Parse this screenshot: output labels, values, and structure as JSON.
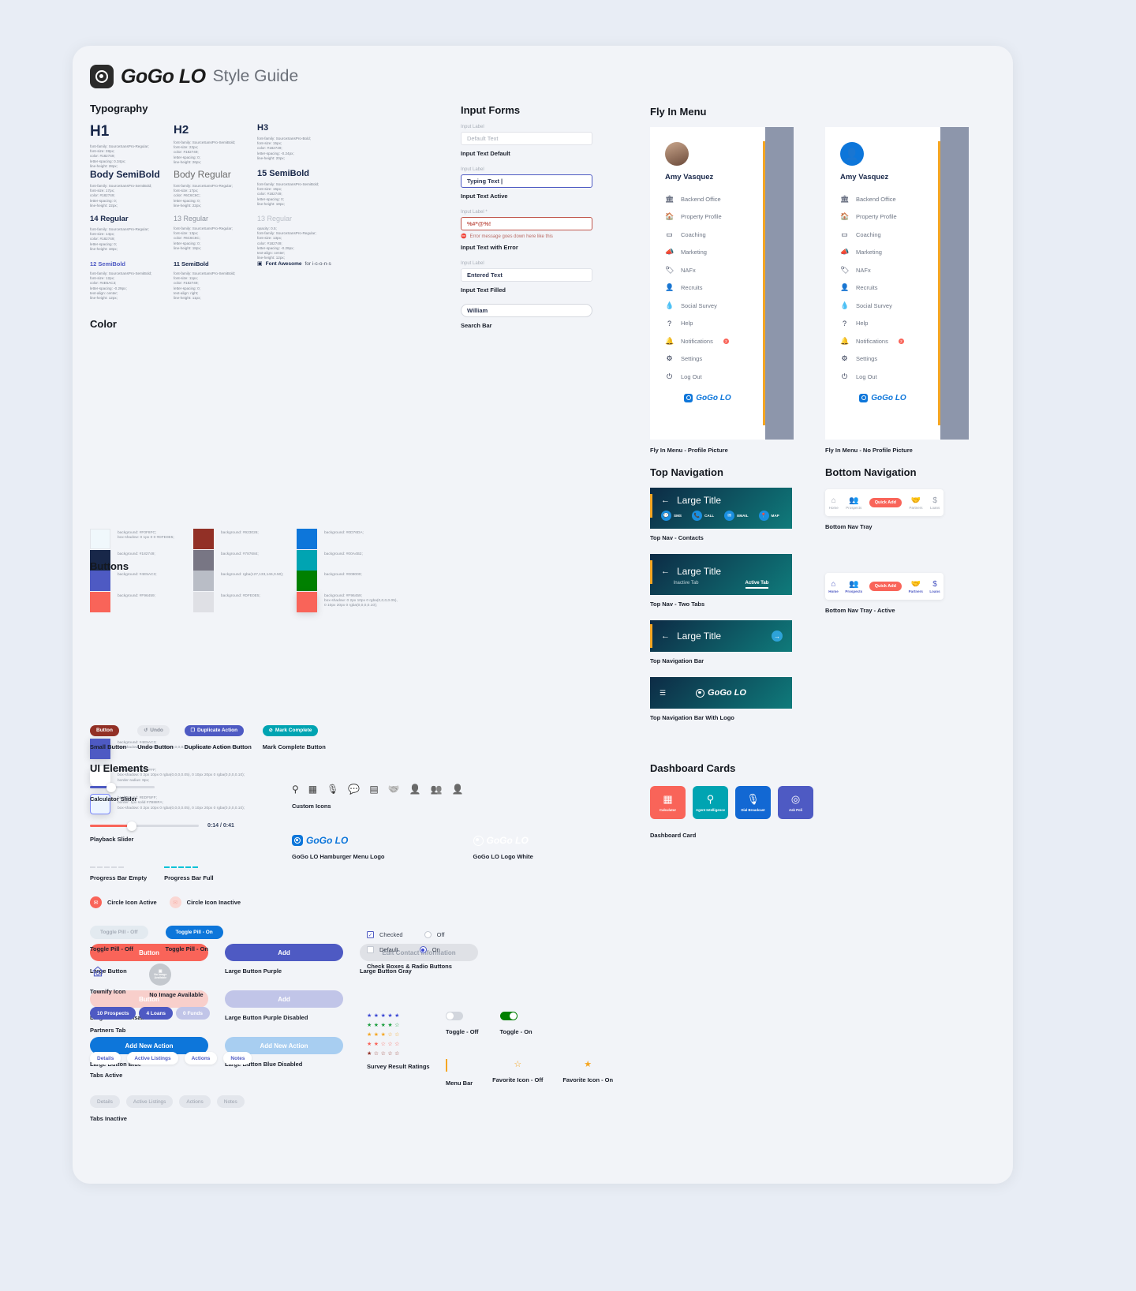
{
  "header": {
    "brand": "GoGo LO",
    "subtitle": "Style Guide"
  },
  "sections": {
    "typography": "Typography",
    "color": "Color",
    "buttons": "Buttons",
    "ui_elements": "UI Elements",
    "input_forms": "Input Forms",
    "fly_in_menu": "Fly In Menu",
    "top_navigation": "Top Navigation",
    "bottom_navigation": "Bottom Navigation",
    "dashboard_cards": "Dashboard Cards"
  },
  "typography": [
    {
      "name": "H1",
      "size": "28px",
      "weight": "bold",
      "color": "#182749",
      "spec": "font-family: SourceSansPro-Regular;\nfont-size: 28px;\ncolor: #182749;\nletter-spacing: 0.34px;\nline-height: 28px;"
    },
    {
      "name": "H2",
      "size": "22px",
      "weight": "bold",
      "color": "#182749",
      "spec": "font-family: SourceSansPro-SemiBold;\nfont-size: 22px;\ncolor: #182749;\nletter-spacing: 0;\nline-height: 26px;"
    },
    {
      "name": "H3",
      "size": "15px",
      "weight": "bold",
      "color": "#182749",
      "spec": "font-family: SourceSansPro-Bold;\nfont-size: 15px;\ncolor: #182749;\nletter-spacing: -0.24px;\nline-height: 20px;"
    },
    {
      "name": "Body SemiBold",
      "size": "17px",
      "weight": "bold",
      "color": "#182749",
      "spec": "font-family: SourceSansPro-SemiBold;\nfont-size: 17px;\ncolor: #182749;\nletter-spacing: 0;\nline-height: 22px;"
    },
    {
      "name": "Body Regular",
      "size": "17px",
      "weight": "normal",
      "color": "#6C6C6C",
      "spec": "font-family: SourceSansPro-Regular;\nfont-size: 17px;\ncolor: #6C6C6C;\nletter-spacing: 0;\nline-height: 22px;"
    },
    {
      "name": "15 SemiBold",
      "size": "15px",
      "weight": "bold",
      "color": "#182749",
      "spec": "font-family: SourceSansPro-SemiBold;\nfont-size: 15px;\ncolor: #182749;\nletter-spacing: 0;\nline-height: 18px;"
    },
    {
      "name": "14 Regular",
      "size": "14px",
      "weight": "bold",
      "color": "#182749",
      "spec": "font-family: SourceSansPro-Regular;\nfont-size: 14px;\ncolor: #182749;\nletter-spacing: 0;\nline-height: 18px;"
    },
    {
      "name": "13 Regular",
      "size": "13px",
      "weight": "normal",
      "color": "#8d939e",
      "spec": "font-family: SourceSansPro-Regular;\nfont-size: 13px;\ncolor: #6C6C6C;\nletter-spacing: 0;\nline-height: 18px;"
    },
    {
      "name": "13 Regular",
      "size": "13px",
      "weight": "normal",
      "color": "#b9bec7",
      "spec": "opacity: 0.5;\nfont-family: SourceSansPro-Regular;\nfont-size: 13px;\ncolor: #182749;\nletter-spacing: -0.29px;\ntext-align: center;\nline-height: 12px;"
    },
    {
      "name": "12 SemiBold",
      "size": "12px",
      "weight": "bold",
      "color": "#4E5AC3",
      "spec": "font-family: SourceSansPro-SemiBold;\nfont-size: 12px;\ncolor: #4E5AC3;\nletter-spacing: -0.29px;\ntext-align: center;\nline-height: 12px;"
    },
    {
      "name": "11 SemiBold",
      "size": "11px",
      "weight": "bold",
      "color": "#182749",
      "spec": "font-family: SourceSansPro-SemiBold;\nfont-size: 11px;\ncolor: #182749;\nletter-spacing: 0;\ntext-align: right;\nline-height: 11px;"
    }
  ],
  "font_awesome_note": {
    "bold": "Font Awesome",
    "rest": "for i-c-o-n-s"
  },
  "colors": [
    {
      "hex": "#F0F8FC",
      "css": "background: #F0F8FC;\nbox-shadow: 0 1px 0 0 #DFE0E5;",
      "border": true
    },
    {
      "hex": "#923026",
      "css": "background: #923026;"
    },
    {
      "hex": "#0D76DA",
      "css": "background: #0D76DA;"
    },
    {
      "hex": "#182749",
      "css": "background: #182749;"
    },
    {
      "hex": "#787684",
      "css": "background: #787684;"
    },
    {
      "hex": "#00A4B2",
      "css": "background: #00A4B2;"
    },
    {
      "hex": "#4E5AC3",
      "css": "background: #4E5AC3;"
    },
    {
      "hex": "#b9bdc6",
      "css": "background: rgba(127,133,146,0.50);"
    },
    {
      "hex": "#008000",
      "css": "background: #008000;"
    },
    {
      "hex": "#F96459",
      "css": "background: #F96459;"
    },
    {
      "hex": "#DFE0E5",
      "css": "background: #DFE0E5;"
    },
    {
      "hex": "#F96459",
      "css": "background: #F96459;\nbox-shadow: 0 2px 10px 0 rgba(0,0,0,0.05), 0 10px 20px 0 rgba(0,0,0,0.10);",
      "shadow": true
    }
  ],
  "colors_wide": [
    {
      "hex": "#4E5AC3",
      "css": "background: #4E5AC3;\nbox-shadow: 0 2px 10px 0 rgba(0,0,0,0.05), 0 10px 20px 0 rgba(0,0,0,0.10);",
      "shadow": true,
      "radius": "0px"
    },
    {
      "hex": "#FFFFFF",
      "css": "background: #FFFFFF;\nbox-shadow: 0 2px 10px 0 rgba(0,0,0,0.05), 0 10px 20px 0 rgba(0,0,0,0.10);\nborder-radius: 8px;",
      "shadow": true,
      "radius": "8px"
    },
    {
      "hex": "#EDF5FF",
      "css": "background: #EDF5FF;\nborder: 1px solid #7B88FA;\nbox-shadow: 0 2px 10px 0 rgba(0,0,0,0.05), 0 10px 20px 0 rgba(0,0,0,0.10);",
      "shadow": true,
      "radius": "4px",
      "outline": "#7B88FA"
    }
  ],
  "buttons": {
    "large": [
      {
        "label": "Button",
        "caption": "Large Button",
        "bg": "#F96459",
        "fg": "#ffffff"
      },
      {
        "label": "Add",
        "caption": "Large Button Purple",
        "bg": "#4E5AC3",
        "fg": "#ffffff"
      },
      {
        "label": "Edit Contact Information",
        "caption": "Large Button Gray",
        "bg": "#dfe1e6",
        "fg": "#9aa1ad"
      },
      {
        "label": "Button",
        "caption": "Large Button Disabled",
        "bg": "#f8cfcb",
        "fg": "#ffffff"
      },
      {
        "label": "Add",
        "caption": "Large Button Purple Disabled",
        "bg": "#c1c5e8",
        "fg": "#ffffff"
      },
      {
        "label": "",
        "caption": "",
        "bg": "",
        "fg": ""
      },
      {
        "label": "Add New Action",
        "caption": "Large Button Blue",
        "bg": "#0D76DA",
        "fg": "#ffffff"
      },
      {
        "label": "Add New Action",
        "caption": "Large Button Blue Disabled",
        "bg": "#a8cef1",
        "fg": "#ffffff"
      }
    ],
    "small": [
      {
        "label": "Button",
        "caption": "Small Button",
        "bg": "#923026",
        "fg": "#ffffff",
        "icon": ""
      },
      {
        "label": "Undo",
        "caption": "Undo Button",
        "bg": "#e6e8ed",
        "fg": "#8a909b",
        "icon": "undo-icon"
      },
      {
        "label": "Duplicate Action",
        "caption": "Duplicate Action Button",
        "bg": "#4E5AC3",
        "fg": "#ffffff",
        "icon": "copy-icon"
      },
      {
        "label": "Mark Complete",
        "caption": "Mark Complete Button",
        "bg": "#00A4B2",
        "fg": "#ffffff",
        "icon": "check-circle-icon"
      }
    ]
  },
  "ui_elements": {
    "calculator_slider": {
      "caption": "Calculator Slider",
      "value": 30,
      "track": "#4E5AC3"
    },
    "playback_slider": {
      "caption": "Playback Slider",
      "value": 38,
      "track": "#F96459",
      "time": "0:14 / 0:41"
    },
    "progress_empty": "Progress Bar Empty",
    "progress_full": "Progress Bar Full",
    "circle_active": "Circle Icon Active",
    "circle_inactive": "Circle Icon Inactive",
    "toggle_pill_off": {
      "label": "Toggle Pill - Off",
      "caption": "Toggle Pill - Off"
    },
    "toggle_pill_on": {
      "label": "Toggle Pill - On",
      "caption": "Toggle Pill - On"
    },
    "townify": "Townify Icon",
    "no_image": {
      "label": "No Image\nAvailable",
      "caption": "No Image Available"
    },
    "partners_tab": {
      "caption": "Partners Tab",
      "items": [
        {
          "label": "10 Prospects",
          "bg": "#4E5AC3",
          "fg": "#ffffff"
        },
        {
          "label": "4 Loans",
          "bg": "#4E5AC3",
          "fg": "#ffffff"
        },
        {
          "label": "0 Funds",
          "bg": "#c1c5e8",
          "fg": "#ffffff"
        }
      ]
    },
    "tabs_active": {
      "caption": "Tabs Active",
      "items": [
        "Details",
        "Active Listings",
        "Actions",
        "Notes"
      ]
    },
    "tabs_inactive": {
      "caption": "Tabs Inactive",
      "items": [
        "Details",
        "Active Listings",
        "Actions",
        "Notes"
      ]
    },
    "custom_icons": {
      "caption": "Custom Icons",
      "icons": [
        "search-dollar-icon",
        "calculator-icon",
        "microphone-icon",
        "comment-dollar-icon",
        "file-invoice-icon",
        "handshake-icon",
        "user-chart-icon",
        "users-icon",
        "user-search-icon"
      ]
    },
    "hamburger_logo_caption": "GoGo LO Hamburger Menu Logo",
    "logo_white_caption": "GoGo LO Logo White",
    "checkboxes": {
      "caption": "Check Boxes & Radio Buttons",
      "checked": "Checked",
      "default": "Default",
      "off": "Off",
      "on": "On"
    },
    "survey": {
      "caption": "Survey Result Ratings",
      "rows": [
        {
          "filled": 5,
          "color": "#3b47d4"
        },
        {
          "filled": 4,
          "color": "#1b9e3e"
        },
        {
          "filled": 3,
          "color": "#f5a623"
        },
        {
          "filled": 2,
          "color": "#f96459"
        },
        {
          "filled": 1,
          "color": "#923026"
        }
      ],
      "total": 5
    },
    "toggle_off": "Toggle - Off",
    "toggle_on": "Toggle - On",
    "menu_bar": "Menu Bar",
    "favorite_off": "Favorite Icon - Off",
    "favorite_on": "Favorite Icon - On"
  },
  "input_forms": [
    {
      "label": "Input Label",
      "value": "Default Text",
      "caption": "Input Text Default",
      "state": "default"
    },
    {
      "label": "Input Label",
      "value": "Typing Text |",
      "caption": "Input Text Active",
      "state": "active"
    },
    {
      "label": "Input Label *",
      "value": "%#*@%!",
      "caption": "Input Text with Error",
      "state": "error",
      "error": "Error message goes down here like this"
    },
    {
      "label": "Input Label",
      "value": "Entered Text",
      "caption": "Input Text Filled",
      "state": "filled"
    },
    {
      "label": "",
      "value": "William",
      "caption": "Search Bar",
      "state": "search"
    }
  ],
  "fly_in": {
    "user_name": "Amy Vasquez",
    "items": [
      {
        "label": "Backend Office",
        "icon": "building-icon"
      },
      {
        "label": "Property Profile",
        "icon": "home-icon"
      },
      {
        "label": "Coaching",
        "icon": "chalkboard-icon"
      },
      {
        "label": "Marketing",
        "icon": "bullhorn-icon"
      },
      {
        "label": "NAFx",
        "icon": "tag-icon"
      },
      {
        "label": "Recruits",
        "icon": "user-tie-icon"
      },
      {
        "label": "Social Survey",
        "icon": "droplet-icon"
      },
      {
        "label": "Help",
        "icon": "question-circle-icon"
      },
      {
        "label": "Notifications",
        "icon": "bell-icon",
        "badge": "2"
      },
      {
        "label": "Settings",
        "icon": "gear-icon"
      },
      {
        "label": "Log Out",
        "icon": "power-icon"
      }
    ],
    "brand": "GoGo LO",
    "caption_profile": "Fly In Menu - Profile Picture",
    "caption_no_profile": "Fly In Menu - No Profile Picture"
  },
  "top_nav": {
    "contacts": {
      "title": "Large Title",
      "caption": "Top Nav - Contacts",
      "actions": [
        {
          "label": "SMS",
          "icon": "comment-icon"
        },
        {
          "label": "CALL",
          "icon": "phone-icon"
        },
        {
          "label": "EMAIL",
          "icon": "envelope-icon"
        },
        {
          "label": "MAP",
          "icon": "map-marker-icon"
        }
      ]
    },
    "two_tabs": {
      "title": "Large Title",
      "caption": "Top Nav - Two Tabs",
      "inactive": "Inactive Tab",
      "active": "Active Tab"
    },
    "bar": {
      "title": "Large Title",
      "caption": "Top Navigation Bar"
    },
    "with_logo": {
      "brand": "GoGo LO",
      "caption": "Top Navigation Bar With Logo"
    }
  },
  "bottom_nav": {
    "tray_caption": "Bottom Nav Tray",
    "tray_active_caption": "Bottom Nav Tray - Active",
    "items": [
      {
        "label": "Home",
        "icon": "home-icon"
      },
      {
        "label": "Prospects",
        "icon": "users-icon"
      },
      {
        "label": "Quick Add",
        "icon": "quick-add-button"
      },
      {
        "label": "Partners",
        "icon": "handshake-icon"
      },
      {
        "label": "Loans",
        "icon": "dollar-icon"
      }
    ]
  },
  "dashboard_cards": {
    "caption": "Dashboard Card",
    "cards": [
      {
        "label": "Calculator",
        "icon": "calculator-icon",
        "bg": "#F96459"
      },
      {
        "label": "Agent Intelligence",
        "icon": "search-user-icon",
        "bg": "#00A4B2"
      },
      {
        "label": "Dial Broadcast",
        "icon": "microphone-icon",
        "bg": "#1268D3"
      },
      {
        "label": "Ask Poli",
        "icon": "poli-icon",
        "bg": "#4E5AC3"
      }
    ]
  }
}
